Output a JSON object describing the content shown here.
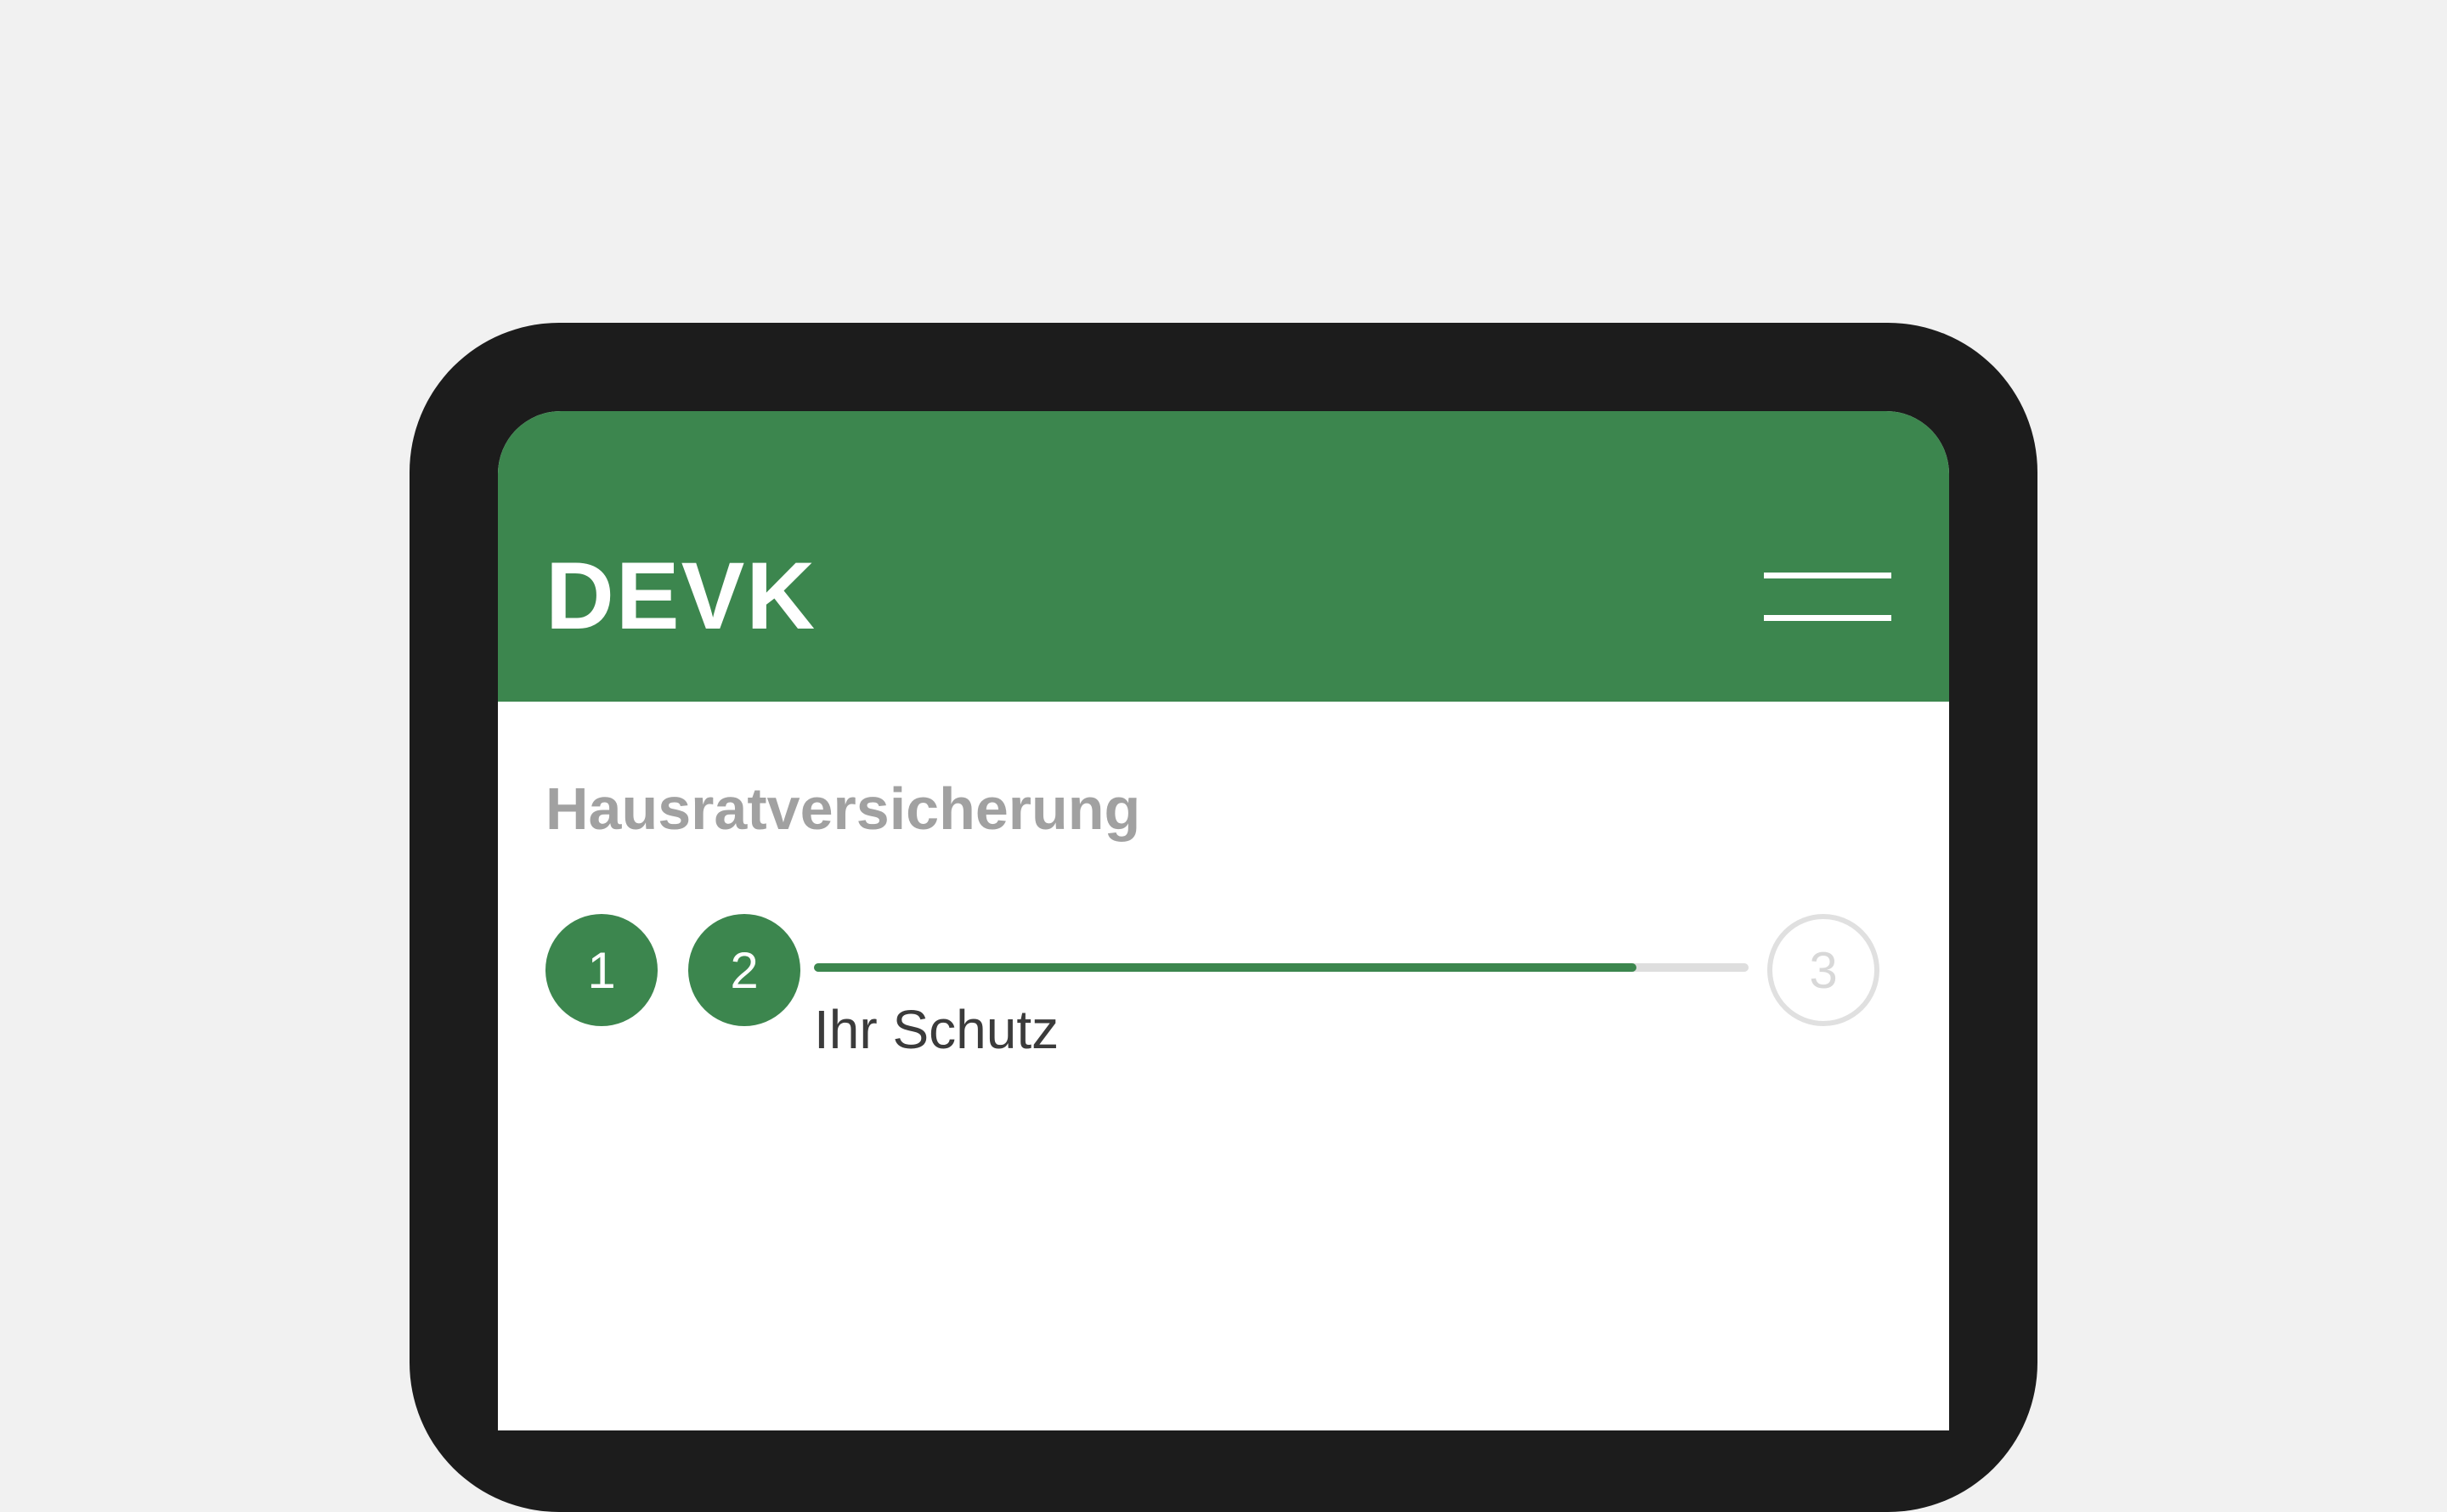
{
  "app": {
    "logo_text": "DEVK",
    "brand_color": "#3c864e"
  },
  "header": {
    "menu_icon": "hamburger-menu-icon"
  },
  "page": {
    "title": "Hausratversicherung"
  },
  "stepper": {
    "steps": [
      {
        "number": "1",
        "state": "completed"
      },
      {
        "number": "2",
        "state": "current"
      },
      {
        "number": "3",
        "state": "upcoming"
      }
    ],
    "current_step_label": "Ihr Schutz",
    "progress_fraction": 0.88
  }
}
